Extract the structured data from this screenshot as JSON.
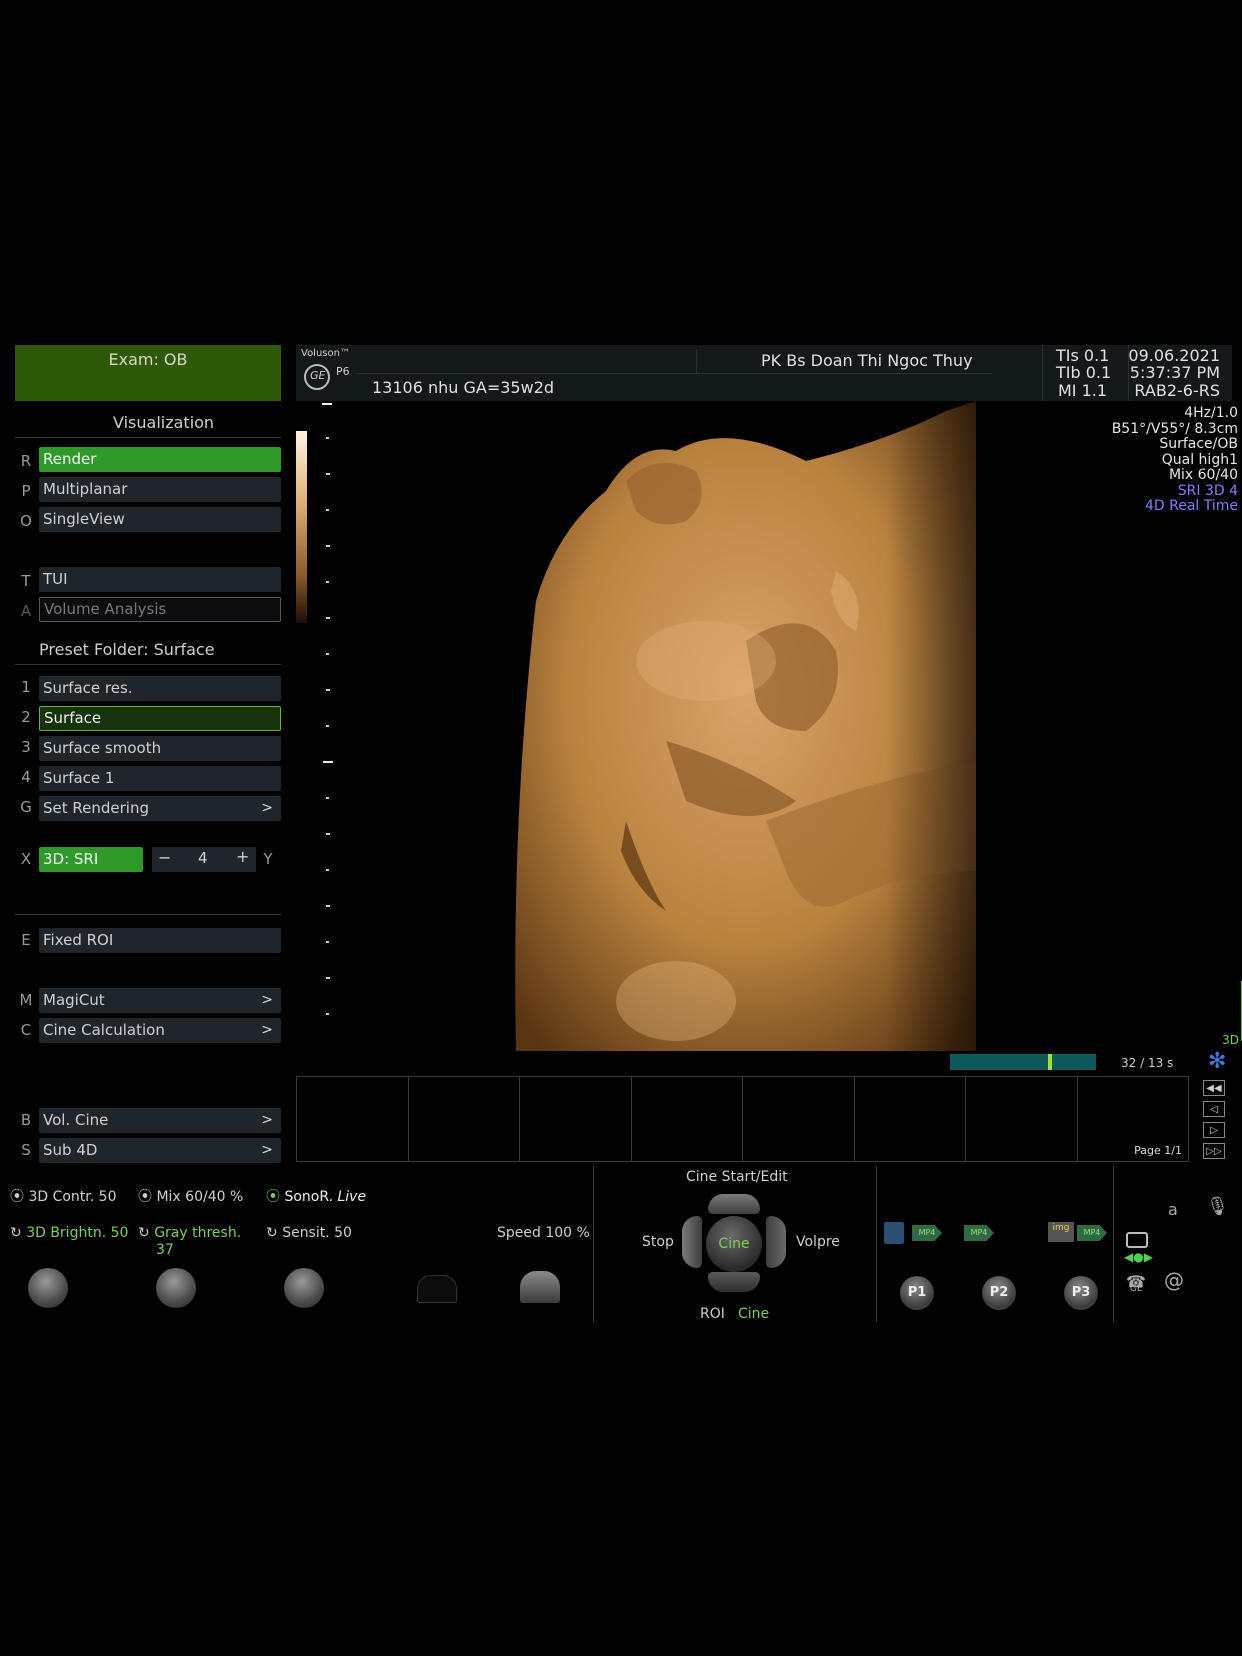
{
  "exam": {
    "label": "Exam:  OB"
  },
  "visualization": {
    "title": "Visualization",
    "items": [
      {
        "key": "R",
        "label": "Render"
      },
      {
        "key": "P",
        "label": "Multiplanar"
      },
      {
        "key": "O",
        "label": "SingleView"
      },
      {
        "key": "T",
        "label": "TUI"
      },
      {
        "key": "A",
        "label": "Volume Analysis"
      }
    ]
  },
  "preset": {
    "title": "Preset Folder: Surface",
    "items": [
      {
        "key": "1",
        "label": "Surface res."
      },
      {
        "key": "2",
        "label": "Surface"
      },
      {
        "key": "3",
        "label": "Surface smooth"
      },
      {
        "key": "4",
        "label": "Surface 1"
      },
      {
        "key": "G",
        "label": "Set Rendering"
      }
    ]
  },
  "sri": {
    "key_left": "X",
    "label": "3D: SRI",
    "minus": "−",
    "value": "4",
    "plus": "+",
    "key_right": "Y"
  },
  "roi": {
    "key": "E",
    "label": "Fixed ROI"
  },
  "tools": [
    {
      "key": "M",
      "label": "MagiCut"
    },
    {
      "key": "C",
      "label": "Cine Calculation"
    }
  ],
  "cine_menu": [
    {
      "key": "B",
      "label": "Vol. Cine"
    },
    {
      "key": "S",
      "label": "Sub 4D"
    }
  ],
  "header": {
    "brand": "Voluson™",
    "probe": "P6",
    "patient": "13106 nhu  GA=35w2d",
    "clinic": "PK Bs Doan Thi  Ngoc Thuy",
    "tis": "TIs  0.1",
    "tib": "TIb  0.1",
    "mi": "MI  1.1",
    "date": "09.06.2021",
    "time": "5:37:37 PM",
    "transducer": "RAB2-6-RS"
  },
  "image_info": {
    "lines": [
      "4Hz/1.0",
      "B51°/V55°/ 8.3cm",
      "Surface/OB",
      "Qual high1",
      "Mix 60/40"
    ],
    "blue_lines": [
      "SRI 3D 4",
      "4D Real Time"
    ],
    "mode": "3D"
  },
  "cine": {
    "progress": 0.69,
    "counter": "32 / 13 s",
    "page": "Page 1/1"
  },
  "controls": {
    "contr": "3D Contr. 50",
    "mix": "Mix 60/40 %",
    "sonor": "SonoR.",
    "sonor_live": "Live",
    "bright": "3D Brightn. 50",
    "gray": "Gray thresh.",
    "gray_val": "37",
    "sensit": "Sensit. 50",
    "speed": "Speed 100 %"
  },
  "cine_pad": {
    "title": "Cine Start/Edit",
    "left": "Stop",
    "center": "Cine",
    "right": "Volpre",
    "bottom_left": "ROI",
    "bottom_right": "Cine"
  },
  "store": {
    "mp4": "MP4",
    "img": "img",
    "p1": "P1",
    "p2": "P2",
    "p3": "P3",
    "ge": "GE",
    "a": "a",
    "at": "@"
  },
  "colors": {
    "accent_green": "#2f9a2a",
    "exam_green": "#2e5a07",
    "info_blue": "#7f7fff"
  }
}
